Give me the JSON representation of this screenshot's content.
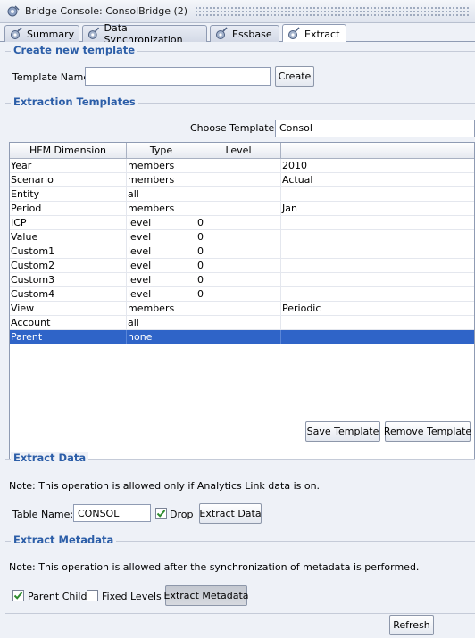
{
  "window": {
    "title": "Bridge Console: ConsolBridge (2)",
    "icon": "bridge-console-icon"
  },
  "tabs": [
    {
      "label": "Summary",
      "icon": "gear-link-icon",
      "active": false
    },
    {
      "label": "Data Synchronization",
      "icon": "gear-link-icon",
      "active": false
    },
    {
      "label": "Essbase",
      "icon": "gear-link-icon",
      "active": false
    },
    {
      "label": "Extract",
      "icon": "gear-link-icon",
      "active": true
    }
  ],
  "create_template": {
    "section_title": "Create new template",
    "name_label": "Template Name:",
    "name_value": "",
    "create_button": "Create"
  },
  "extraction_templates": {
    "section_title": "Extraction Templates",
    "choose_label": "Choose Template:",
    "choose_value": "Consol",
    "columns": [
      "HFM Dimension",
      "Type",
      "Level",
      ""
    ],
    "rows": [
      {
        "dimension": "Year",
        "type": "members",
        "level": "",
        "value": "2010"
      },
      {
        "dimension": "Scenario",
        "type": "members",
        "level": "",
        "value": "Actual"
      },
      {
        "dimension": "Entity",
        "type": "all",
        "level": "",
        "value": ""
      },
      {
        "dimension": "Period",
        "type": "members",
        "level": "",
        "value": "Jan"
      },
      {
        "dimension": "ICP",
        "type": "level",
        "level": "0",
        "value": ""
      },
      {
        "dimension": "Value",
        "type": "level",
        "level": "0",
        "value": ""
      },
      {
        "dimension": "Custom1",
        "type": "level",
        "level": "0",
        "value": ""
      },
      {
        "dimension": "Custom2",
        "type": "level",
        "level": "0",
        "value": ""
      },
      {
        "dimension": "Custom3",
        "type": "level",
        "level": "0",
        "value": ""
      },
      {
        "dimension": "Custom4",
        "type": "level",
        "level": "0",
        "value": ""
      },
      {
        "dimension": "View",
        "type": "members",
        "level": "",
        "value": "Periodic"
      },
      {
        "dimension": "Account",
        "type": "all",
        "level": "",
        "value": ""
      },
      {
        "dimension": "Parent",
        "type": "none",
        "level": "",
        "value": "",
        "selected": true
      }
    ],
    "save_button": "Save Template",
    "remove_button": "Remove Template"
  },
  "extract_data": {
    "section_title": "Extract Data",
    "note": "Note: This operation is allowed only if Analytics Link data is on.",
    "table_name_label": "Table Name:",
    "table_name_value": "CONSOL",
    "drop_label": "Drop",
    "drop_checked": true,
    "extract_button": "Extract Data"
  },
  "extract_metadata": {
    "section_title": "Extract Metadata",
    "note": "Note: This operation is allowed after the synchronization of metadata is performed.",
    "parent_child_label": "Parent Child",
    "parent_child_checked": true,
    "fixed_levels_label": "Fixed Levels",
    "fixed_levels_checked": false,
    "extract_button": "Extract Metadata"
  },
  "refresh_button": "Refresh",
  "colors": {
    "section_title": "#2c5ea8",
    "selection": "#2f64c8",
    "panel_bg": "#eef1f7"
  }
}
